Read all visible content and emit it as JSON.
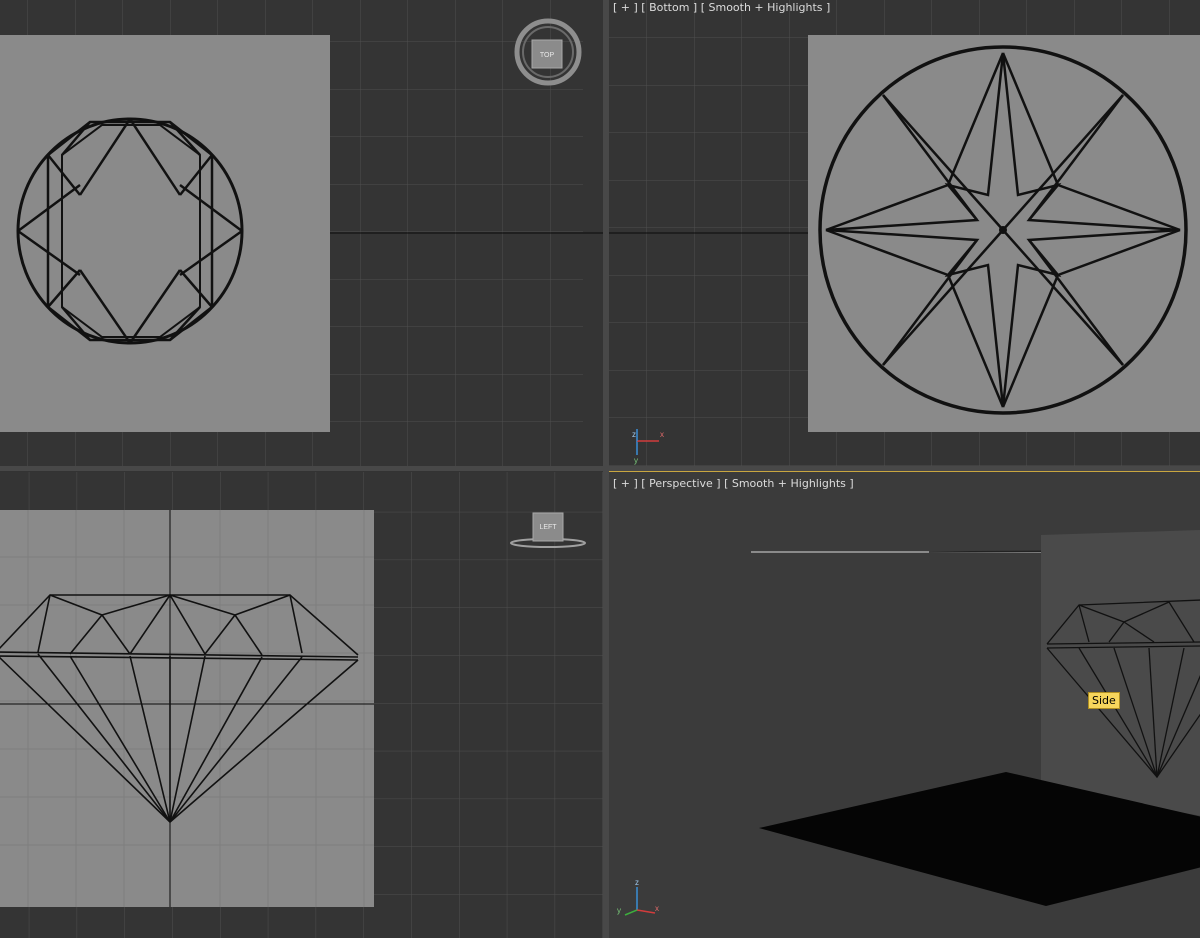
{
  "viewports": {
    "top": {
      "label": "",
      "viewcube_face": "TOP"
    },
    "bottom": {
      "label": "[ + ] [ Bottom ] [ Smooth + Highlights ]"
    },
    "left": {
      "label": "",
      "viewcube_face": "LEFT"
    },
    "perspective": {
      "label": "[ + ] [ Perspective ] [ Smooth + Highlights ]",
      "tooltip": "Side"
    }
  },
  "axes": {
    "x": "x",
    "y": "y",
    "z": "z"
  },
  "colors": {
    "viewport_bg": "#343434",
    "grid_line": "#4e4e4e",
    "axis_line": "#0a0a0a",
    "plane_gray": "#8a8a8a",
    "active_border": "#c9a640",
    "tooltip_bg": "#f7d65c"
  }
}
